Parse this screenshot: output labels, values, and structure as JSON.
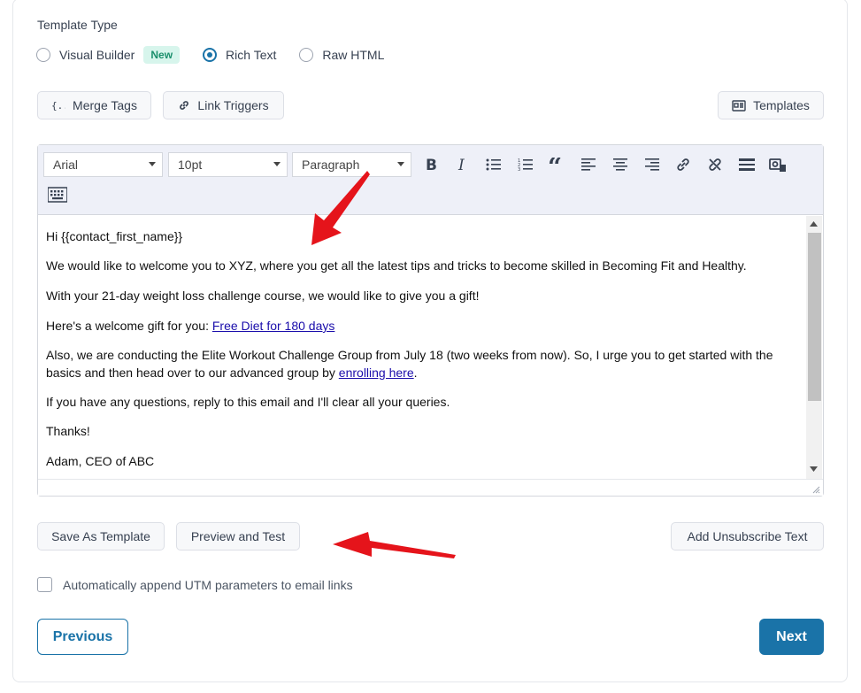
{
  "template_type": {
    "label": "Template Type",
    "options": [
      {
        "label": "Visual Builder",
        "checked": false,
        "badge": "New"
      },
      {
        "label": "Rich Text",
        "checked": true
      },
      {
        "label": "Raw HTML",
        "checked": false
      }
    ]
  },
  "actions_top": {
    "merge_tags": "Merge Tags",
    "link_triggers": "Link Triggers",
    "templates": "Templates"
  },
  "toolbar": {
    "font_family": "Arial",
    "font_size": "10pt",
    "block_format": "Paragraph",
    "icons": [
      "bold-icon",
      "italic-icon",
      "bullet-list-icon",
      "numbered-list-icon",
      "blockquote-icon",
      "align-left-icon",
      "align-center-icon",
      "align-right-icon",
      "link-icon",
      "unlink-icon",
      "horizontal-rule-icon",
      "image-icon",
      "keyboard-icon"
    ]
  },
  "email_body": {
    "greeting": "Hi {{contact_first_name}}",
    "p1": "We would like to welcome you to XYZ, where you get all the latest tips and tricks to become skilled in Becoming Fit and Healthy.",
    "p2": "With your 21-day weight loss challenge course, we would like to give you a gift!",
    "p3_prefix": "Here's a welcome gift for you: ",
    "p3_link": "Free Diet for 180 days",
    "p4_prefix": "Also, we are conducting the Elite Workout Challenge Group from July 18 (two weeks from now). So, I urge you to get started with the basics and then head over to our advanced group by ",
    "p4_link": "enrolling here",
    "p4_suffix": ".",
    "p5": "If you have any questions, reply to this email and I'll clear all your queries.",
    "p6": "Thanks!",
    "signature": "Adam, CEO of ABC"
  },
  "actions_bottom": {
    "save_template": "Save As Template",
    "preview_test": "Preview and Test",
    "add_unsubscribe": "Add Unsubscribe Text"
  },
  "utm": {
    "label": "Automatically append UTM parameters to email links",
    "checked": false
  },
  "nav": {
    "previous": "Previous",
    "next": "Next"
  },
  "colors": {
    "accent": "#1a73a8",
    "badge_bg": "#d7f5ec",
    "badge_text": "#1a8f6c",
    "annotation_arrow": "#e5141b"
  }
}
